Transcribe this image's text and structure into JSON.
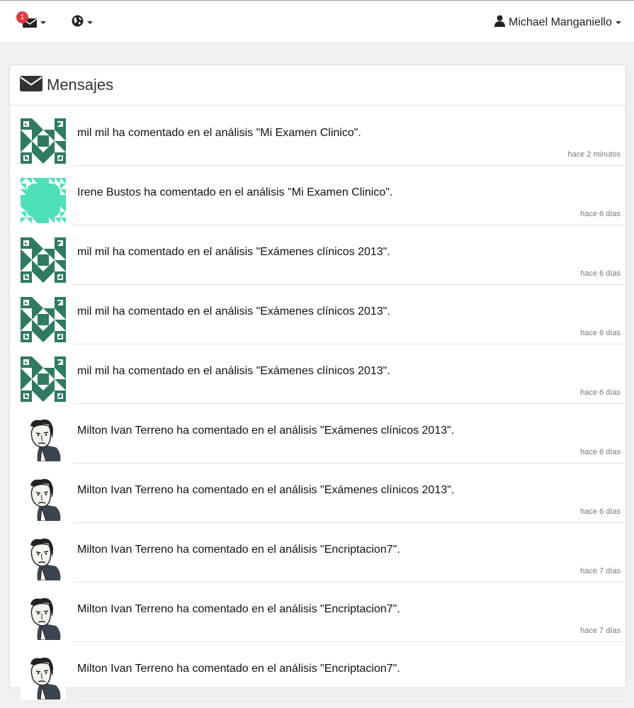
{
  "navbar": {
    "messages_badge": "1",
    "user_name": "Michael Manganiello"
  },
  "panel": {
    "title": "Mensajes"
  },
  "messages": [
    {
      "text": "mil mil ha comentado en el análisis \"Mi Examen Clinico\".",
      "time": "hace 2 minutos",
      "avatar": "identicon-green-dark"
    },
    {
      "text": "Irene Bustos ha comentado en el análisis \"Mi Examen Clinico\".",
      "time": "hace 6 días",
      "avatar": "identicon-mint"
    },
    {
      "text": "mil mil ha comentado en el análisis \"Exámenes clínicos 2013\".",
      "time": "hace 6 días",
      "avatar": "identicon-green-dark"
    },
    {
      "text": "mil mil ha comentado en el análisis \"Exámenes clínicos 2013\".",
      "time": "hace 6 días",
      "avatar": "identicon-green-dark"
    },
    {
      "text": "mil mil ha comentado en el análisis \"Exámenes clínicos 2013\".",
      "time": "hace 6 días",
      "avatar": "identicon-green-dark"
    },
    {
      "text": "Milton Ivan Terreno ha comentado en el análisis \"Exámenes clínicos 2013\".",
      "time": "hace 6 días",
      "avatar": "portrait-sketch"
    },
    {
      "text": "Milton Ivan Terreno ha comentado en el análisis \"Exámenes clínicos 2013\".",
      "time": "hace 6 días",
      "avatar": "portrait-sketch"
    },
    {
      "text": "Milton Ivan Terreno ha comentado en el análisis \"Encriptacion7\".",
      "time": "hace 7 días",
      "avatar": "portrait-sketch"
    },
    {
      "text": "Milton Ivan Terreno ha comentado en el análisis \"Encriptacion7\".",
      "time": "hace 7 días",
      "avatar": "portrait-sketch"
    },
    {
      "text": "Milton Ivan Terreno ha comentado en el análisis \"Encriptacion7\".",
      "time": "",
      "avatar": "portrait-sketch"
    }
  ],
  "colors": {
    "badge": "#e0393e",
    "identicon_dark": "#2e7a63",
    "identicon_mint": "#4fe0b9"
  }
}
